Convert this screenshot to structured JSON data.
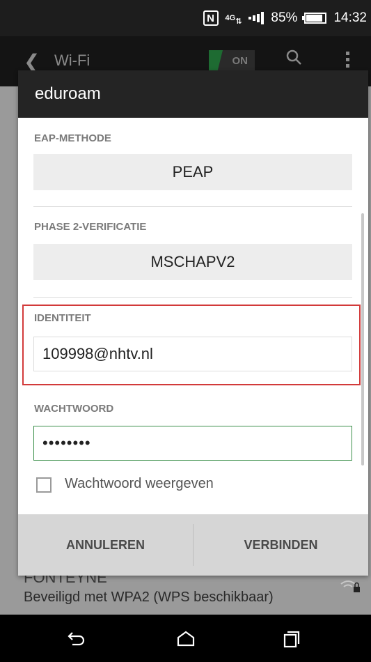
{
  "status_bar": {
    "nfc": "N",
    "network": "4G",
    "battery": "85%",
    "battery_level": 0.85,
    "time": "14:32"
  },
  "app_bar": {
    "title": "Wi-Fi",
    "toggle_label": "ON"
  },
  "background_item": {
    "name": "FONTEYNE",
    "subtitle": "Beveiligd met WPA2 (WPS beschikbaar)"
  },
  "dialog": {
    "title": "eduroam",
    "eap_label": "EAP-METHODE",
    "eap_value": "PEAP",
    "phase2_label": "PHASE 2-VERIFICATIE",
    "phase2_value": "MSCHAPV2",
    "identity_label": "IDENTITEIT",
    "identity_value": "109998@nhtv.nl",
    "password_label": "WACHTWOORD",
    "password_value": "••••••••",
    "show_password_label": "Wachtwoord weergeven",
    "cancel_label": "ANNULEREN",
    "connect_label": "VERBINDEN"
  },
  "colors": {
    "highlight": "#d23a3a",
    "active_field": "#3b8f4a",
    "toggle_green": "#1e6b32"
  },
  "icons": {
    "back": "chevron-left-icon",
    "search": "search-icon",
    "menu": "overflow-menu-icon",
    "nav_back": "back-arrow-icon",
    "nav_home": "home-icon",
    "nav_recents": "recents-icon",
    "wifi_lock": "wifi-lock-icon"
  }
}
